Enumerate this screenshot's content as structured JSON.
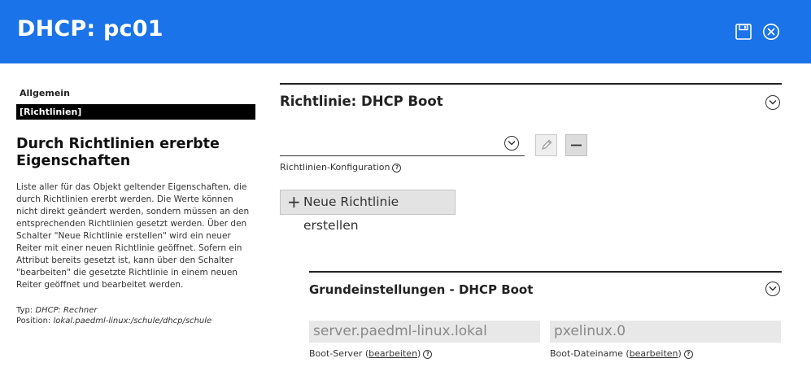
{
  "header": {
    "title": "DHCP: pc01",
    "save_icon": "save-icon",
    "close_icon": "close-icon",
    "background": "#1a73e8"
  },
  "sidebar": {
    "categories": [
      {
        "label": "Allgemein",
        "active": false
      },
      {
        "label": "[Richtlinien]",
        "active": true
      }
    ],
    "title": "Durch Richtlinien ererbte Eigenschaften",
    "description": "Liste aller für das Objekt geltender Eigenschaften, die durch Richtlinien ererbt werden. Die Werte können nicht direkt geändert werden, sondern müssen an den entsprechenden Richtlinien gesetzt werden. Über den Schalter \"Neue Richtlinie erstellen\" wird ein neuer Reiter mit einer neuen Richtlinie geöffnet. Sofern ein Attribut bereits gesetzt ist, kann über den Schalter \"bearbeiten\" die gesetzte Richtlinie in einem neuen Reiter geöffnet und bearbeitet werden.",
    "type_label": "Typ:",
    "type_value": "DHCP: Rechner",
    "position_label": "Position:",
    "position_value": "lokal.paedml-linux:/schule/dhcp/schule"
  },
  "policy_section": {
    "title": "Richtlinie: DHCP Boot",
    "select_value": "",
    "select_label": "Richtlinien-Konfiguration",
    "new_policy_button": "Neue Richtlinie erstellen"
  },
  "basic_section": {
    "title": "Grundeinstellungen - DHCP Boot",
    "boot_server_value": "server.paedml-linux.lokal",
    "boot_server_label": "Boot-Server",
    "boot_file_value": "pxelinux.0",
    "boot_file_label": "Boot-Dateiname",
    "edit_link": "bearbeiten"
  }
}
